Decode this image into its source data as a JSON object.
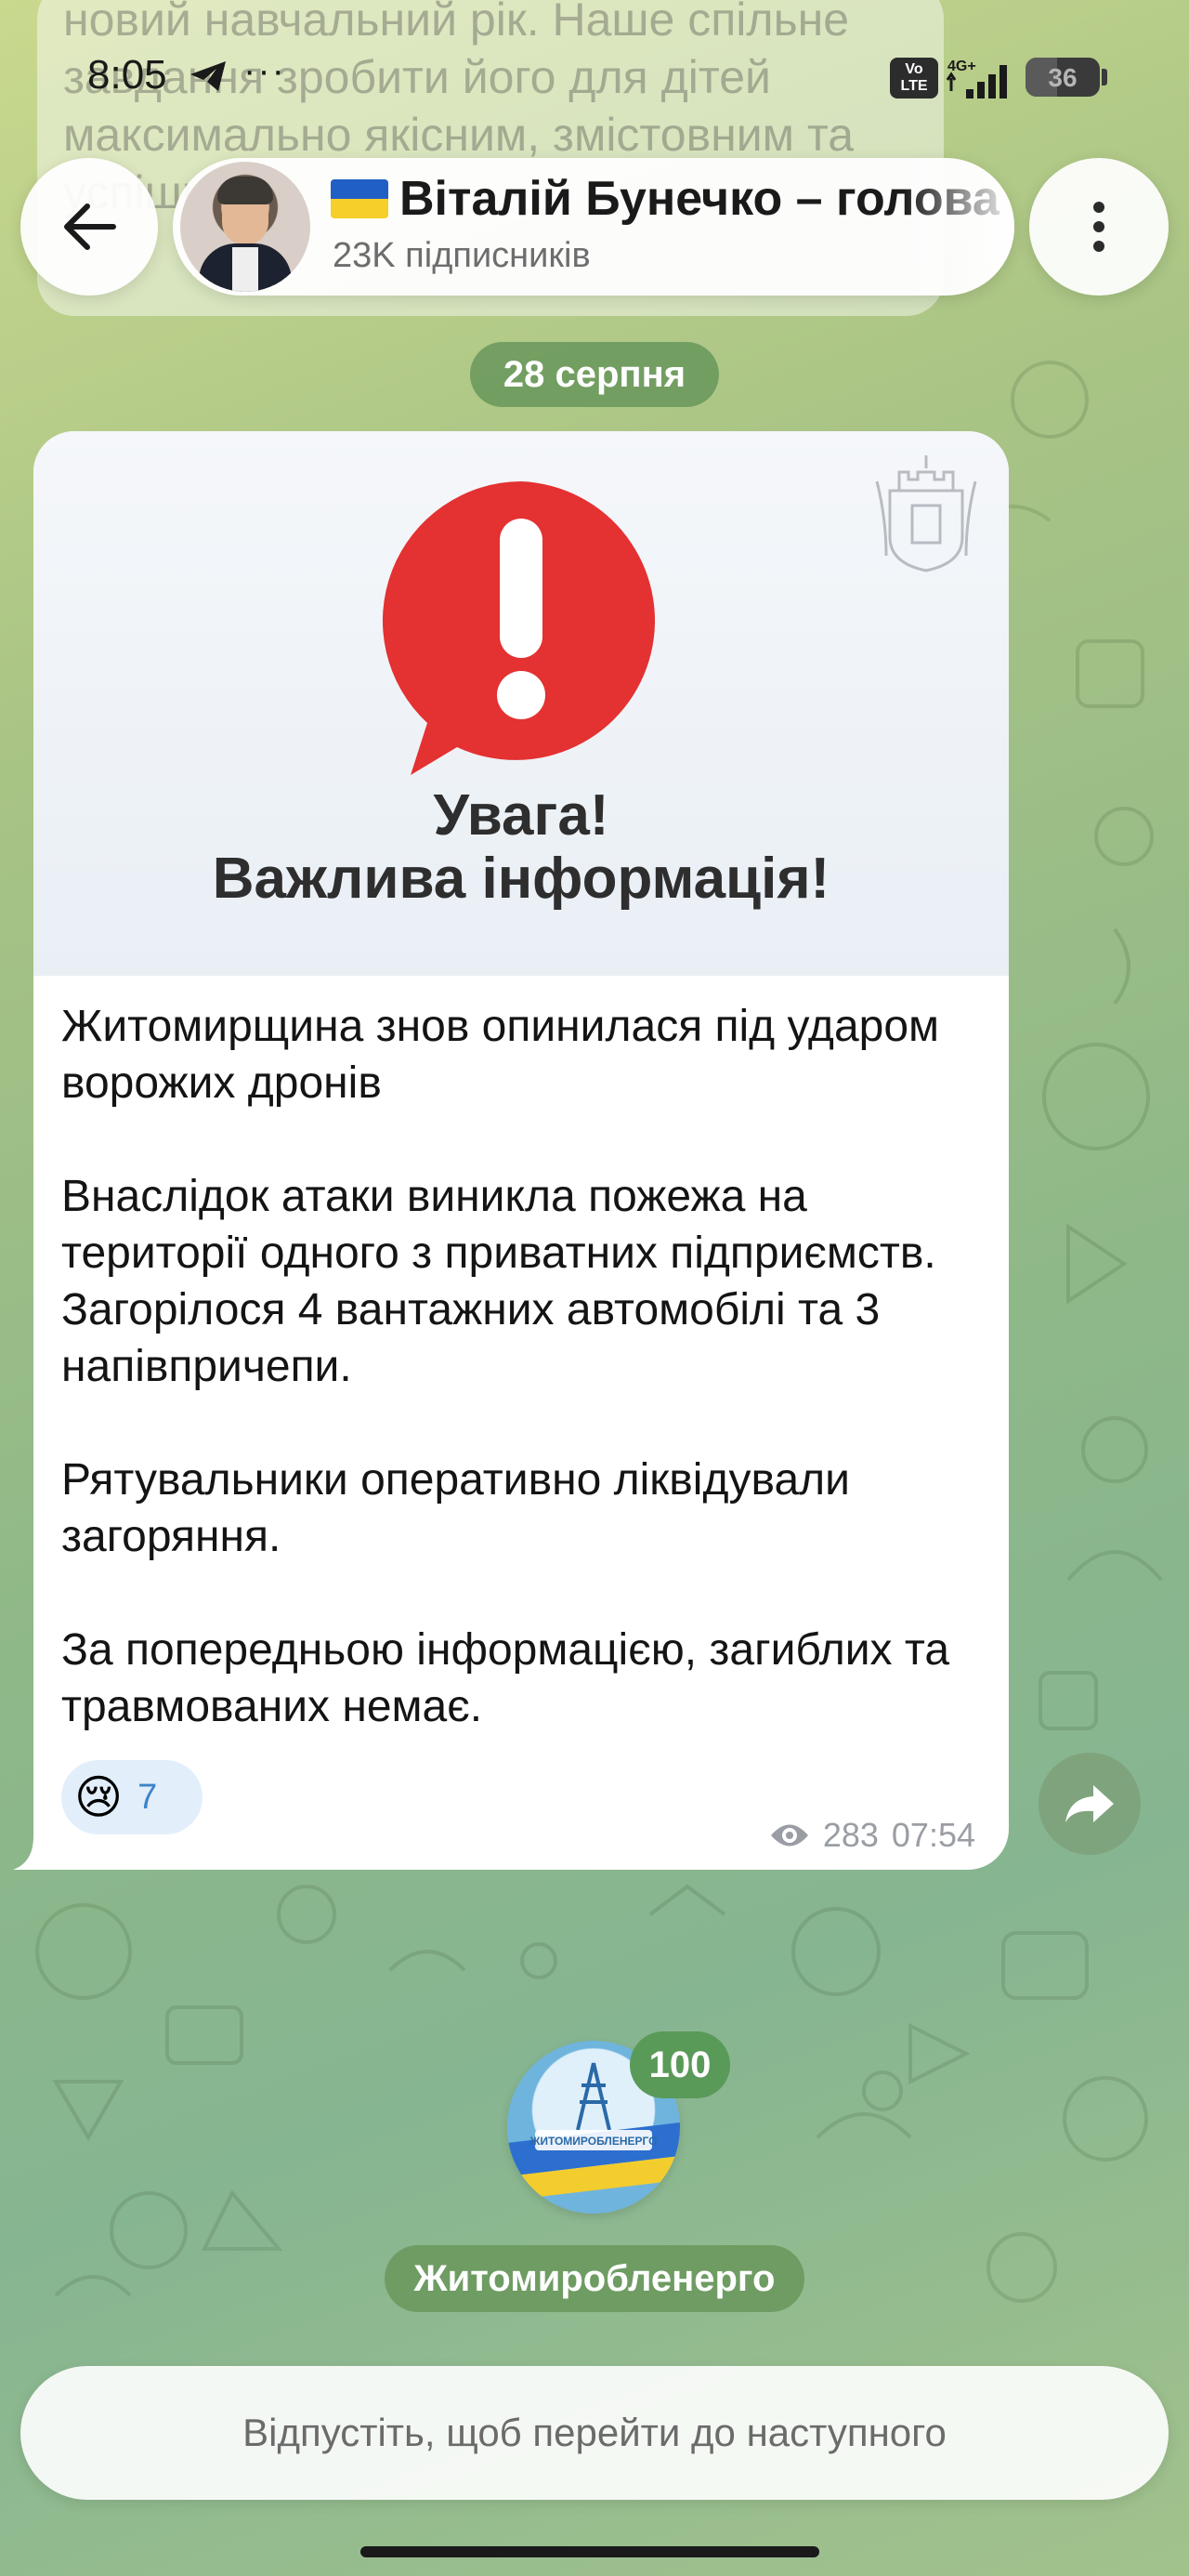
{
  "status_bar": {
    "time": "8:05",
    "dots": "···",
    "volte": "Vo LTE",
    "network": "4G+",
    "battery": "36"
  },
  "previous_message": {
    "text": "новий навчальний рік. Наше спільне завдання зробити його для дітей максимально якісним, змістовним та успішним"
  },
  "header": {
    "channel_title": "Віталій Бунечко – голова",
    "subscribers": "23K підписників"
  },
  "date_chip": "28 серпня",
  "post": {
    "image": {
      "headline_line1": "Увага!",
      "headline_line2": "Важлива інформація!"
    },
    "paragraphs": [
      "Житомирщина знов опинилася під ударом ворожих дронів",
      "Внаслідок  атаки виникла пожежа на території одного з приватних підприємств. Загорілося 4 вантажних автомобілі та 3 напівпричепи.",
      "Рятувальники оперативно ліквідували загоряння.",
      "За попередньою інформацією, загиблих та травмованих немає."
    ],
    "reaction": {
      "emoji": "😢",
      "count": "7"
    },
    "views": "283",
    "time": "07:54"
  },
  "next_channel": {
    "unread_count": "100",
    "name": "Житомиробленерго",
    "logo_text": "ЖИТОМИРОБЛЕНЕРГО"
  },
  "release_hint": "Відпустіть, щоб перейти до наступного",
  "colors": {
    "accent_green": "#68965c",
    "alert_red": "#e43131",
    "link_blue": "#3b84c8"
  }
}
